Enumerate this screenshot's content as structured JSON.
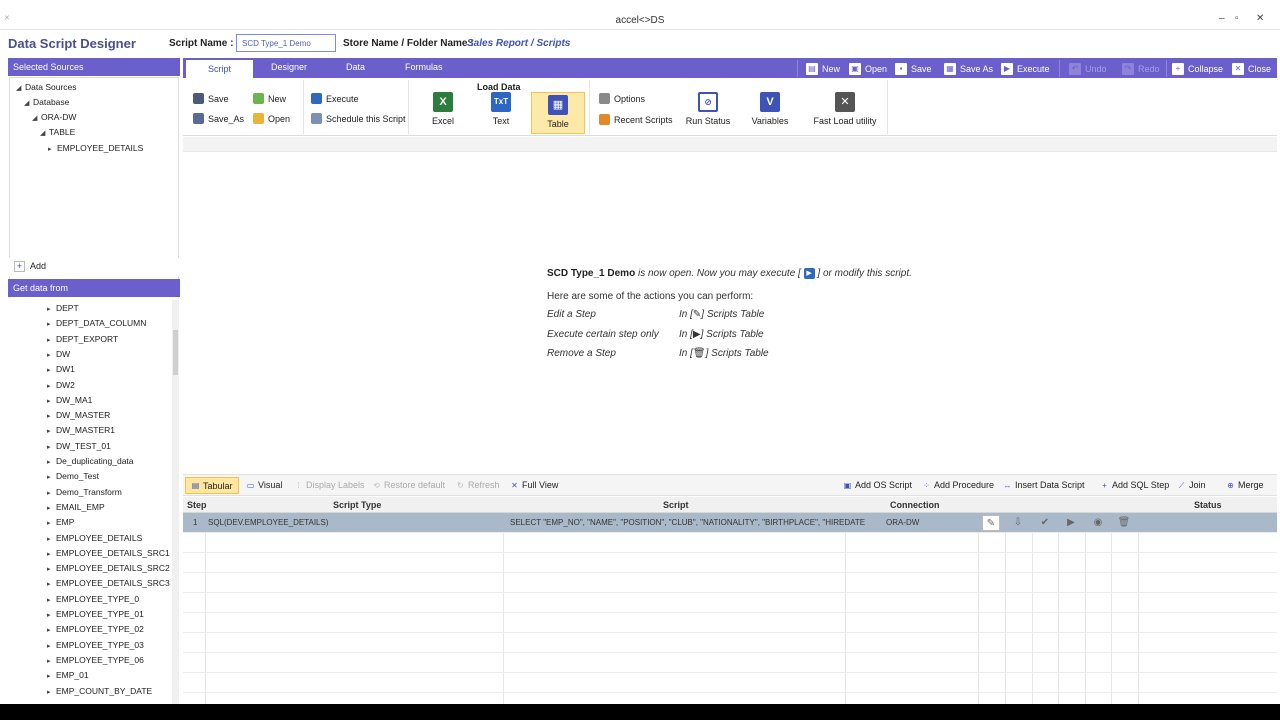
{
  "window": {
    "title": "accel<>DS",
    "min": "–",
    "max": "▫",
    "close": "✕"
  },
  "header": {
    "app_title": "Data Script Designer",
    "script_name_label": "Script Name :",
    "script_name_value": "SCD Type_1 Demo",
    "store_label": "Store Name / Folder Name :",
    "store_value": "Sales Report / Scripts"
  },
  "left": {
    "selected_sources_title": "Selected Sources",
    "tree": [
      {
        "label": "Data Sources"
      },
      {
        "label": "Database"
      },
      {
        "label": "ORA-DW"
      },
      {
        "label": "TABLE"
      },
      {
        "label": "EMPLOYEE_DETAILS"
      }
    ],
    "add_label": "Add",
    "get_data_title": "Get data from",
    "tables": [
      "DEPT",
      "DEPT_DATA_COLUMN",
      "DEPT_EXPORT",
      "DW",
      "DW1",
      "DW2",
      "DW_MA1",
      "DW_MASTER",
      "DW_MASTER1",
      "DW_TEST_01",
      "De_duplicating_data",
      "Demo_Test",
      "Demo_Transform",
      "EMAIL_EMP",
      "EMP",
      "EMPLOYEE_DETAILS",
      "EMPLOYEE_DETAILS_SRC1",
      "EMPLOYEE_DETAILS_SRC2",
      "EMPLOYEE_DETAILS_SRC3",
      "EMPLOYEE_TYPE_0",
      "EMPLOYEE_TYPE_01",
      "EMPLOYEE_TYPE_02",
      "EMPLOYEE_TYPE_03",
      "EMPLOYEE_TYPE_06",
      "EMP_01",
      "EMP_COUNT_BY_DATE"
    ]
  },
  "ribbon": {
    "tabs": [
      "Script",
      "Designer",
      "Data",
      "Formulas"
    ],
    "toolbar": {
      "new": "New",
      "open": "Open",
      "save": "Save",
      "save_as": "Save As",
      "execute": "Execute",
      "undo": "Undo",
      "redo": "Redo",
      "collapse": "Collapse",
      "close": "Close"
    },
    "file": {
      "save": "Save",
      "save_as": "Save_As",
      "new": "New",
      "open": "Open"
    },
    "run": {
      "execute": "Execute",
      "schedule": "Schedule this Script"
    },
    "load_data": {
      "title": "Load Data",
      "excel": "Excel",
      "text": "Text",
      "table": "Table"
    },
    "misc": {
      "options": "Options",
      "recent": "Recent Scripts",
      "run_status": "Run Status",
      "variables": "Variables",
      "fast_load": "Fast Load utility"
    }
  },
  "message": {
    "script": "SCD Type_1 Demo",
    "open_text": "is now open. Now you may execute [",
    "open_text2": "] or modify this script.",
    "actions_intro": "Here are some of the actions you can perform:",
    "actions": [
      {
        "name": "Edit a Step",
        "where_a": "In [",
        "where_b": "] Scripts Table"
      },
      {
        "name": "Execute certain step only",
        "where_a": "In [",
        "where_b": "] Scripts Table"
      },
      {
        "name": "Remove a Step",
        "where_a": "In [",
        "where_b": "] Scripts Table"
      }
    ]
  },
  "bottom_toolbar": {
    "tabular": "Tabular",
    "visual": "Visual",
    "display_labels": "Display Labels",
    "restore_default": "Restore default",
    "refresh": "Refresh",
    "full_view": "Full View",
    "add_os": "Add OS Script",
    "add_proc": "Add Procedure",
    "insert_ds": "Insert Data Script",
    "add_sql": "Add SQL Step",
    "join": "Join",
    "merge": "Merge"
  },
  "table": {
    "columns": [
      "Step",
      "Script Type",
      "Script",
      "Connection",
      "Status"
    ],
    "rows": [
      {
        "step": "1",
        "type": "SQL(DEV.EMPLOYEE_DETAILS)",
        "script": "SELECT \"EMP_NO\", \"NAME\", \"POSITION\", \"CLUB\", \"NATIONALITY\", \"BIRTHPLACE\", \"HIREDATE",
        "connection": "ORA-DW",
        "status": ""
      }
    ]
  }
}
